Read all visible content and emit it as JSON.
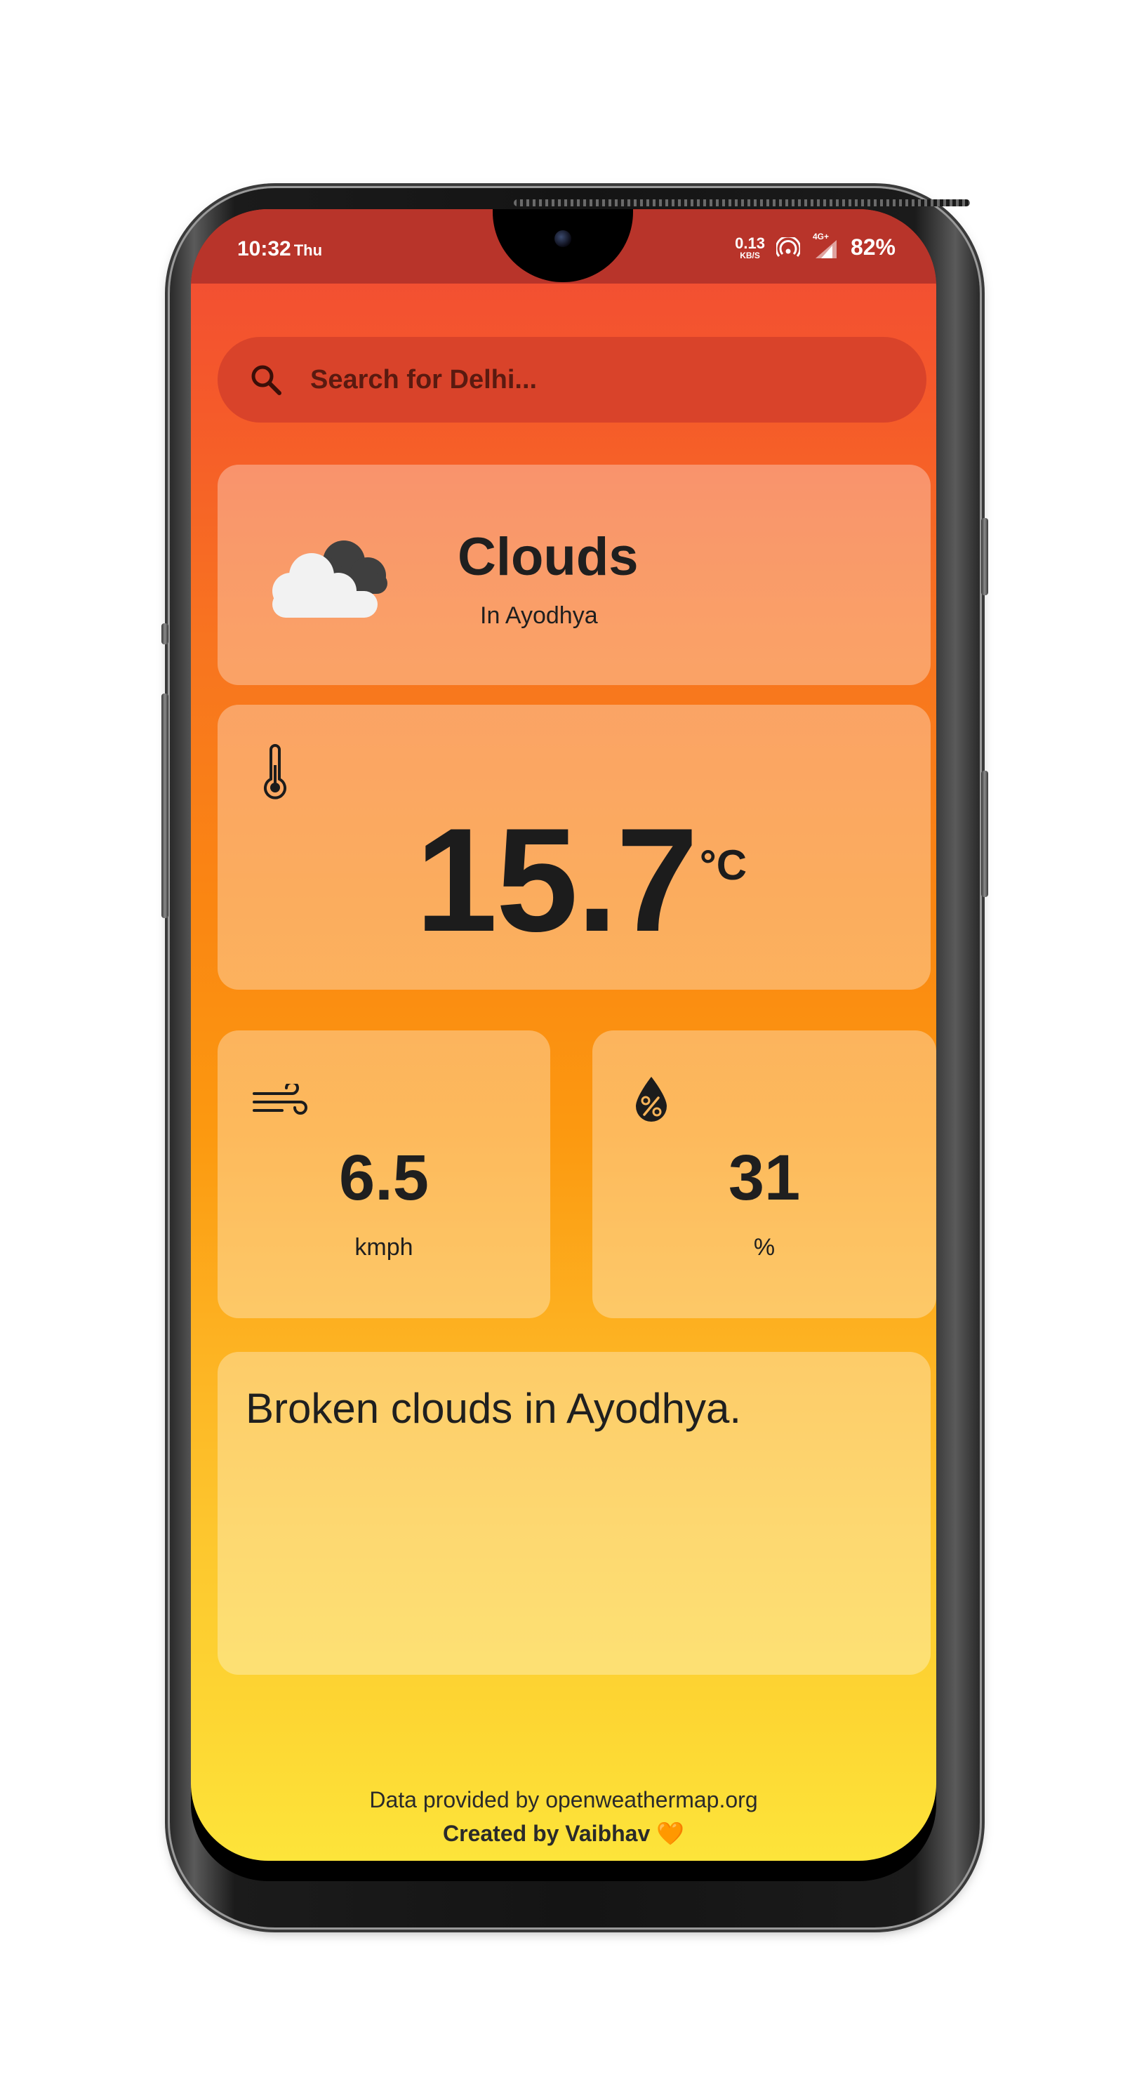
{
  "status_bar": {
    "time": "10:32",
    "day": "Thu",
    "net_speed": "0.13",
    "net_unit": "KB/S",
    "network": "4G+",
    "battery": "82%"
  },
  "search": {
    "placeholder": "Search for Delhi..."
  },
  "weather": {
    "main": "Clouds",
    "location_line": "In Ayodhya",
    "icon": "cloud-icon"
  },
  "temperature": {
    "value": "15.7",
    "unit": "°C",
    "icon": "thermometer-icon"
  },
  "wind": {
    "value": "6.5",
    "unit": "kmph",
    "icon": "wind-icon"
  },
  "humidity": {
    "value": "31",
    "unit": "%",
    "icon": "humidity-icon"
  },
  "description": "Broken clouds in Ayodhya.",
  "footer": {
    "credit": "Data provided by openweathermap.org",
    "author": "Created by Vaibhav",
    "heart": "🧡"
  },
  "colors": {
    "gradient_top": "#f14a36",
    "gradient_bottom": "#fde43a",
    "status_bar": "#b8342a",
    "search_bg": "#d9432a"
  }
}
